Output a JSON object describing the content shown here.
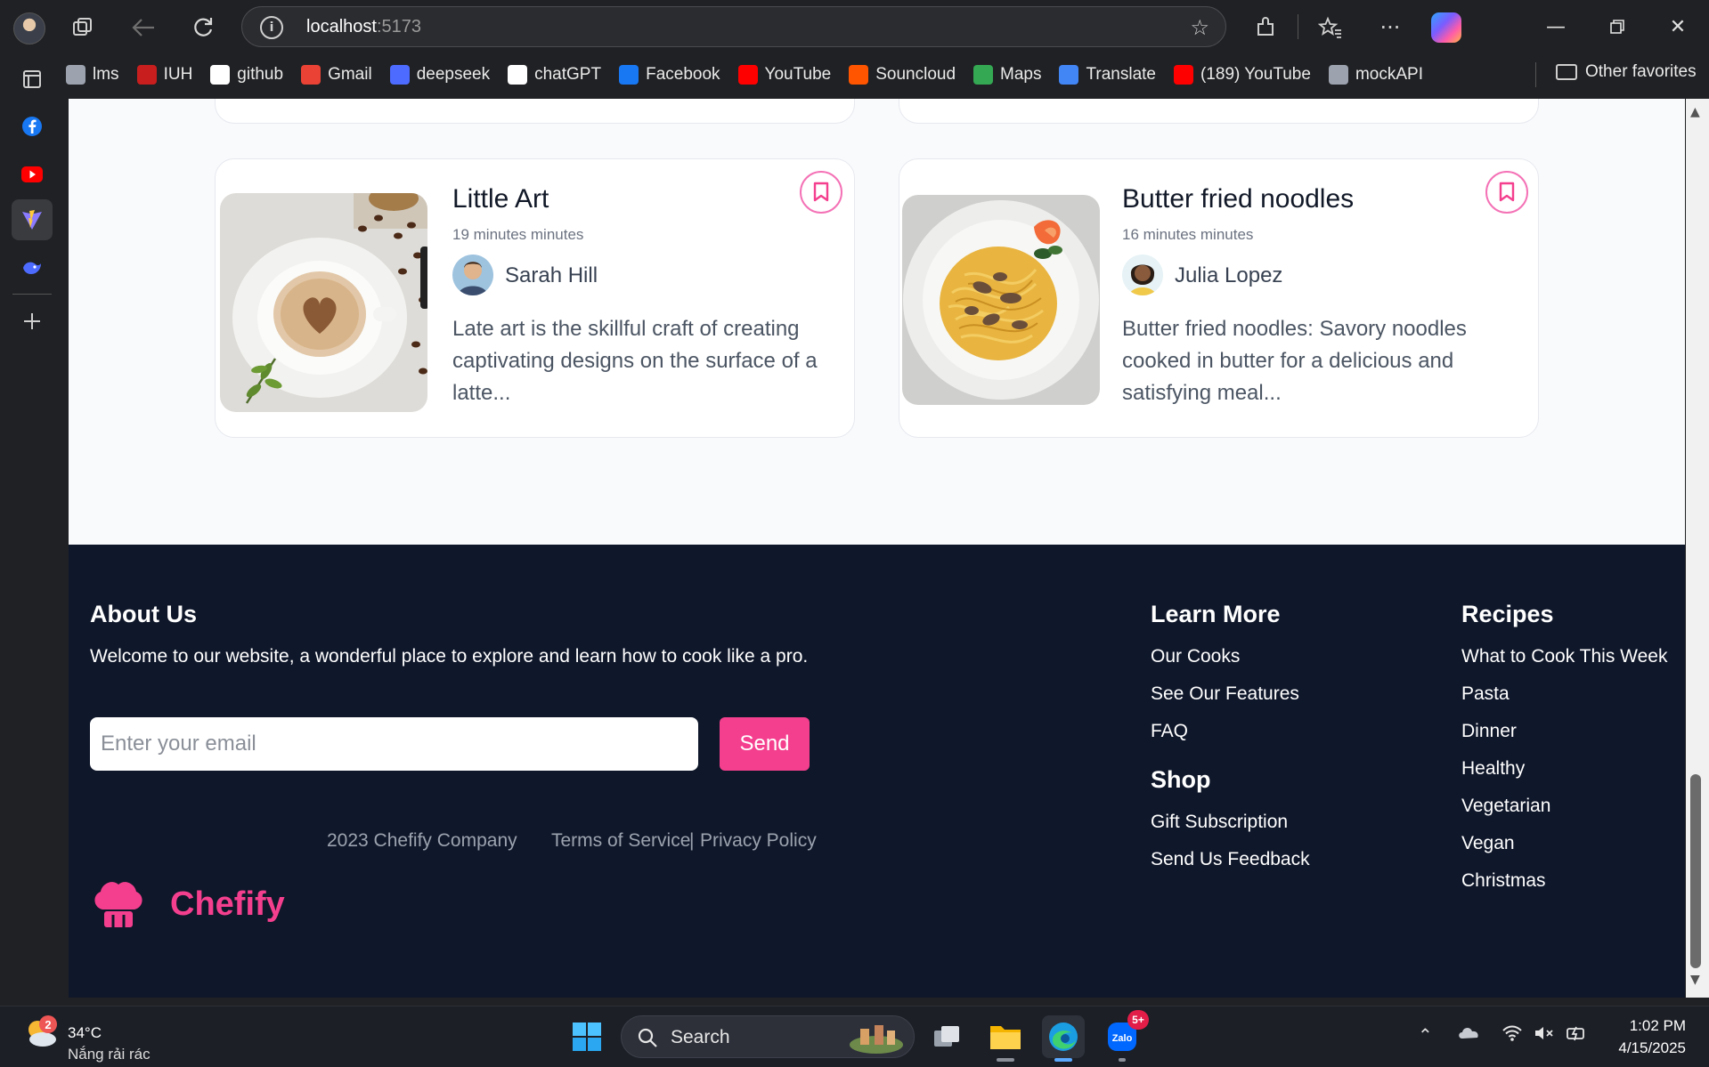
{
  "browser": {
    "url_host": "localhost",
    "url_port": ":5173"
  },
  "bookmarks": [
    {
      "label": "lms",
      "icon": "lms-icon",
      "color": "#9ca3af"
    },
    {
      "label": "IUH",
      "icon": "iuh-icon",
      "color": "#c81e1e"
    },
    {
      "label": "github",
      "icon": "github-icon",
      "color": "#ffffff"
    },
    {
      "label": "Gmail",
      "icon": "gmail-icon",
      "color": "#ea4335"
    },
    {
      "label": "deepseek",
      "icon": "deepseek-icon",
      "color": "#4d6bfe"
    },
    {
      "label": "chatGPT",
      "icon": "chatgpt-icon",
      "color": "#ffffff"
    },
    {
      "label": "Facebook",
      "icon": "facebook-icon",
      "color": "#1877f2"
    },
    {
      "label": "YouTube",
      "icon": "youtube-icon",
      "color": "#ff0000"
    },
    {
      "label": "Souncloud",
      "icon": "soundcloud-icon",
      "color": "#ff5500"
    },
    {
      "label": "Maps",
      "icon": "maps-icon",
      "color": "#34a853"
    },
    {
      "label": "Translate",
      "icon": "translate-icon",
      "color": "#4285f4"
    },
    {
      "label": "(189) YouTube",
      "icon": "youtube-icon",
      "color": "#ff0000"
    },
    {
      "label": "mockAPI",
      "icon": "mockapi-icon",
      "color": "#9ca3af"
    }
  ],
  "other_favorites": "Other favorites",
  "cards": [
    {
      "title": "Little Art",
      "time": "19 minutes minutes",
      "author": "Sarah Hill",
      "description": "Late art is the skillful craft of creating captivating designs on the surface of a latte..."
    },
    {
      "title": "Butter fried noodles",
      "time": "16 minutes minutes",
      "author": "Julia Lopez",
      "description": "Butter fried noodles: Savory noodles cooked in butter for a delicious and satisfying meal..."
    }
  ],
  "footer": {
    "about_title": "About Us",
    "about_text": "Welcome to our website, a wonderful place to explore and learn how to cook like a pro.",
    "email_placeholder": "Enter your email",
    "send_label": "Send",
    "learn_more_title": "Learn More",
    "learn_more_links": [
      "Our Cooks",
      "See Our Features",
      "FAQ"
    ],
    "shop_title": "Shop",
    "shop_links": [
      "Gift Subscription",
      "Send Us Feedback"
    ],
    "recipes_title": "Recipes",
    "recipes_links": [
      "What to Cook This Week",
      "Pasta",
      "Dinner",
      "Healthy",
      "Vegetarian",
      "Vegan",
      "Christmas"
    ],
    "brand": "Chefify",
    "copyright": "2023 Chefify Company",
    "terms": "Terms of Service",
    "separator": "|",
    "privacy": "Privacy Policy",
    "accent_color": "#f43f8e"
  },
  "taskbar": {
    "weather_temp": "34°C",
    "weather_desc": "Nắng rải rác",
    "weather_badge": "2",
    "search_label": "Search",
    "zalo_badge": "5+",
    "time": "1:02 PM",
    "date": "4/15/2025"
  }
}
